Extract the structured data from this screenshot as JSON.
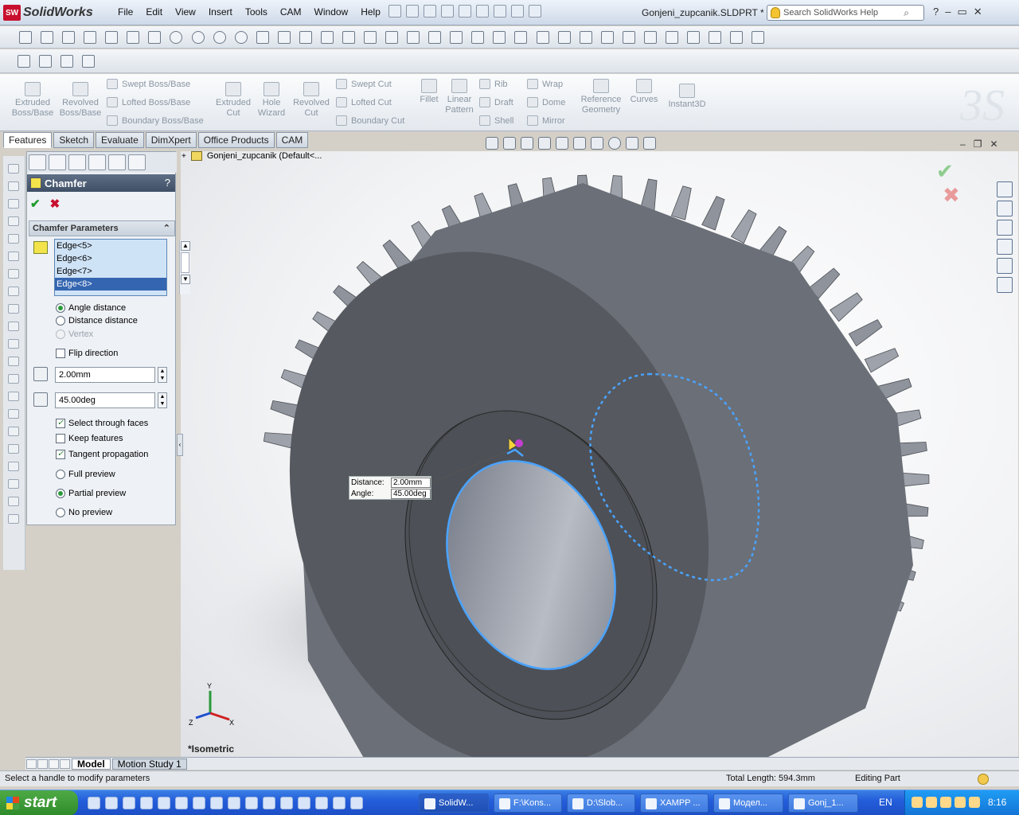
{
  "app": {
    "logo_text": "SolidWorks",
    "logo_badge": "SW",
    "document_title": "Gonjeni_zupcanik.SLDPRT *",
    "search_placeholder": "Search SolidWorks Help"
  },
  "menu": [
    "File",
    "Edit",
    "View",
    "Insert",
    "Tools",
    "CAM",
    "Window",
    "Help"
  ],
  "command_manager": {
    "large_buttons": [
      {
        "label": "Extruded\nBoss/Base"
      },
      {
        "label": "Revolved\nBoss/Base"
      },
      {
        "label": "Extruded\nCut"
      },
      {
        "label": "Hole\nWizard"
      },
      {
        "label": "Revolved\nCut"
      },
      {
        "label": "Fillet"
      },
      {
        "label": "Linear\nPattern"
      },
      {
        "label": "Reference\nGeometry"
      },
      {
        "label": "Curves"
      },
      {
        "label": "Instant3D"
      }
    ],
    "small_buttons": {
      "boss": [
        "Swept Boss/Base",
        "Lofted Boss/Base",
        "Boundary Boss/Base"
      ],
      "cut": [
        "Swept Cut",
        "Lofted Cut",
        "Boundary Cut"
      ],
      "features1": [
        "Rib",
        "Draft",
        "Shell"
      ],
      "features2": [
        "Wrap",
        "Dome",
        "Mirror"
      ]
    }
  },
  "tabs": [
    {
      "label": "Features",
      "active": true
    },
    {
      "label": "Sketch"
    },
    {
      "label": "Evaluate"
    },
    {
      "label": "DimXpert"
    },
    {
      "label": "Office Products"
    },
    {
      "label": "CAM"
    }
  ],
  "property_manager": {
    "title": "Chamfer",
    "help": "?",
    "ok": "✔",
    "cancel": "✖",
    "section_title": "Chamfer Parameters",
    "edges": [
      "Edge<5>",
      "Edge<6>",
      "Edge<7>",
      "Edge<8>"
    ],
    "selected_edge": "Edge<8>",
    "options": {
      "angle_distance": "Angle distance",
      "distance_distance": "Distance distance",
      "vertex": "Vertex",
      "flip_direction": "Flip direction",
      "select_through_faces": "Select through faces",
      "keep_features": "Keep features",
      "tangent_propagation": "Tangent propagation",
      "full_preview": "Full preview",
      "partial_preview": "Partial preview",
      "no_preview": "No preview"
    },
    "distance_value": "2.00mm",
    "angle_value": "45.00deg"
  },
  "tree": {
    "root": "Gonjeni_zupcanik  (Default<..."
  },
  "callout": {
    "distance_label": "Distance:",
    "distance_value": "2.00mm",
    "angle_label": "Angle:",
    "angle_value": "45.00deg"
  },
  "view_label": "*Isometric",
  "triad": {
    "x": "X",
    "y": "Y",
    "z": "Z"
  },
  "bottom_tabs": [
    "Model",
    "Motion Study 1"
  ],
  "status": {
    "message": "Select a handle to modify parameters",
    "total_length": "Total Length: 594.3mm",
    "mode": "Editing Part"
  },
  "taskbar": {
    "start": "start",
    "items": [
      "SolidW...",
      "F:\\Kons...",
      "D:\\Slob...",
      "XAMPP ...",
      "Модел...",
      "Gonj_1..."
    ],
    "lang": "EN",
    "clock": "8:16"
  },
  "colors": {
    "gear": "#5b5f66",
    "gear_teeth": "#8e939c",
    "selection": "#4aa3ff",
    "ok_green": "#1f9b2c",
    "cancel_red": "#c8102e"
  }
}
